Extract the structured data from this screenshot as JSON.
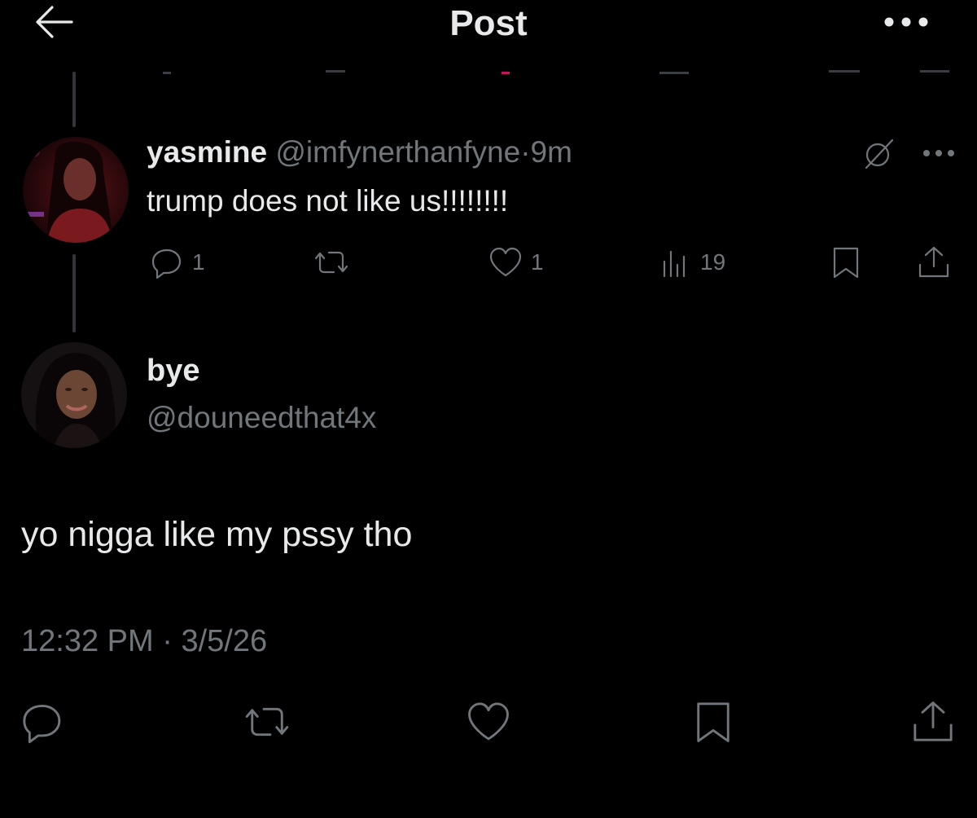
{
  "header": {
    "title": "Post",
    "back_icon": "arrow-left-icon",
    "more_icon": "more-horizontal-icon"
  },
  "parent_tweet": {
    "display_name": "yasmine",
    "handle": "@imfynerthanfyne",
    "separator": "·",
    "time": "9m",
    "text": "trump does not like us!!!!!!!!",
    "replies": "1",
    "likes": "1",
    "views": "19"
  },
  "main_tweet": {
    "display_name": "bye",
    "handle": "@douneedthat4x",
    "text": "yo nigga like my pssy tho",
    "time": "12:32 PM",
    "separator": "·",
    "date": "3/5/26"
  },
  "colors": {
    "background": "#000000",
    "text": "#e7e9ea",
    "muted": "#71767b",
    "divider": "#333639"
  }
}
